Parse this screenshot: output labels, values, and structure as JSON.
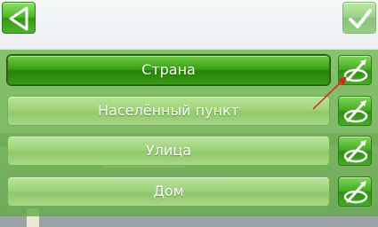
{
  "header": {
    "back_icon": "back-triangle-icon",
    "confirm_icon": "checkmark-icon"
  },
  "fields": [
    {
      "label": "Страна",
      "selected": true
    },
    {
      "label": "Населённый пункт",
      "selected": false
    },
    {
      "label": "Улица",
      "selected": false
    },
    {
      "label": "Дом",
      "selected": false
    }
  ],
  "map_pick_icon": "map-pick-icon",
  "colors": {
    "accent_green": "#3a9e16",
    "annotation_arrow": "#e0201b"
  }
}
